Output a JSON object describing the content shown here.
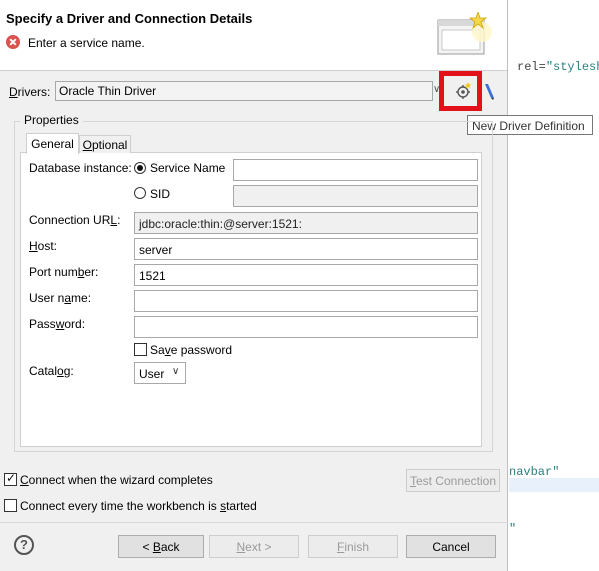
{
  "dialog": {
    "title": "Specify a Driver and Connection Details",
    "message": "Enter a service name."
  },
  "editor": {
    "line1_attr": "rel=",
    "line1_value": "\"stylesh",
    "line2": "navbar\"",
    "line3": "\""
  },
  "drivers": {
    "label_underlined": "D",
    "label_rest": "rivers:",
    "value": "Oracle Thin Driver",
    "new_driver_tooltip": "New Driver Definition"
  },
  "properties": {
    "group_title": "Properties",
    "tabs": {
      "general": "General",
      "optional_underlined": "O",
      "optional_rest": "ptional"
    },
    "database_instance_label": "Database instance:",
    "service_name_label": "Service Name",
    "service_name_value": "",
    "sid_label": "SID",
    "sid_value": "",
    "connection_url_label_pre": "Connection UR",
    "connection_url_label_u": "L",
    "connection_url_label_post": ":",
    "connection_url_value": "jdbc:oracle:thin:@server:1521:",
    "host_label_u": "H",
    "host_label_rest": "ost:",
    "host_value": "server",
    "port_label_pre": "Port num",
    "port_label_u": "b",
    "port_label_post": "er:",
    "port_value": "1521",
    "username_label_pre": "User n",
    "username_label_u": "a",
    "username_label_post": "me:",
    "username_value": "",
    "password_label_pre": "Pass",
    "password_label_u": "w",
    "password_label_post": "ord:",
    "password_value": "",
    "save_password_pre": "Sa",
    "save_password_u": "v",
    "save_password_post": "e password",
    "catalog_label_pre": "Catal",
    "catalog_label_u": "o",
    "catalog_label_post": "g:",
    "catalog_value": "User"
  },
  "options": {
    "connect_when_complete_u": "C",
    "connect_when_complete_rest": "onnect when the wizard completes",
    "connect_every_time_pre": "Connect every time the workbench is ",
    "connect_every_time_u": "s",
    "connect_every_time_post": "tarted",
    "test_connection_u": "T",
    "test_connection_rest": "est Connection"
  },
  "buttons": {
    "help": "?",
    "back_pre": "< ",
    "back_u": "B",
    "back_post": "ack",
    "next_u": "N",
    "next_rest": "ext >",
    "finish_u": "F",
    "finish_rest": "inish",
    "cancel": "Cancel"
  },
  "colors": {
    "highlight_box": "#e2111a",
    "error_icon": "#d9534f"
  }
}
